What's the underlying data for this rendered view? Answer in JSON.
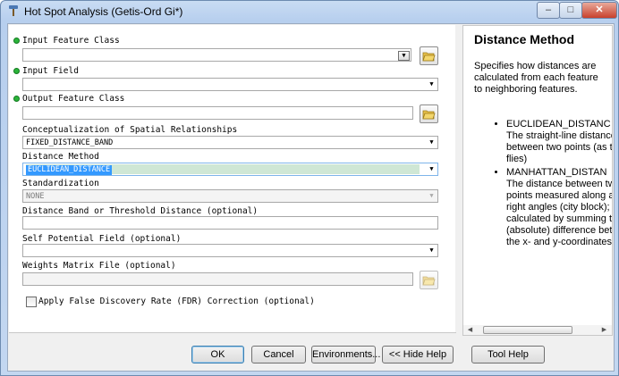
{
  "window": {
    "title": "Hot Spot Analysis (Getis-Ord Gi*)",
    "controls": {
      "minimize": "–",
      "maximize": "□",
      "close": "✕"
    }
  },
  "form": {
    "input_feature_class": {
      "label": "Input Feature Class",
      "value": ""
    },
    "input_field": {
      "label": "Input Field",
      "value": ""
    },
    "output_feature_class": {
      "label": "Output Feature Class",
      "value": ""
    },
    "conceptualization": {
      "label": "Conceptualization of Spatial Relationships",
      "value": "FIXED_DISTANCE_BAND"
    },
    "distance_method": {
      "label": "Distance Method",
      "value": "EUCLIDEAN_DISTANCE"
    },
    "standardization": {
      "label": "Standardization",
      "value": "NONE"
    },
    "distance_band": {
      "label": "Distance Band or Threshold Distance (optional)",
      "value": ""
    },
    "self_potential": {
      "label": "Self Potential Field (optional)",
      "value": ""
    },
    "weights_matrix": {
      "label": "Weights Matrix File (optional)",
      "value": ""
    },
    "fdr": {
      "label": "Apply False Discovery Rate (FDR) Correction (optional)",
      "checked": false
    }
  },
  "help": {
    "title": "Distance Method",
    "description": "Specifies how distances are calculated from each feature to neighboring features.",
    "items": [
      {
        "name": "EUCLIDEAN_DISTANC",
        "text": "The straight-line distance between two points (as the crow flies)"
      },
      {
        "name": "MANHATTAN_DISTAN",
        "text": "The distance between two points measured along axes at right angles (city block); calculated by summing the (absolute) difference between the x- and y-coordinates"
      }
    ]
  },
  "buttons": {
    "ok": "OK",
    "cancel": "Cancel",
    "environments": "Environments...",
    "hide_help": "<< Hide Help",
    "tool_help": "Tool Help"
  },
  "icons": {
    "app": "hammer-tool-icon",
    "folder": "open-folder-icon",
    "required": "green-dot-required-icon",
    "dropdown": "dropdown-arrow-icon"
  },
  "colors": {
    "required_dot": "#2bb43a",
    "selection": "#cfe7d5",
    "titlebar": "#c9dcf3"
  }
}
